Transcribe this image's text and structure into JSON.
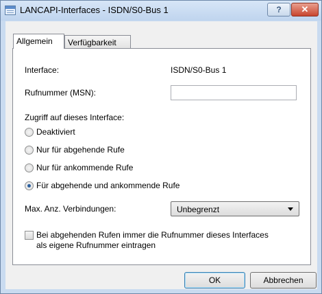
{
  "window": {
    "title": "LANCAPI-Interfaces - ISDN/S0-Bus 1",
    "help_glyph": "?",
    "close_glyph": "✕"
  },
  "tabs": [
    {
      "label": "Allgemein",
      "selected": true
    },
    {
      "label": "Verfügbarkeit",
      "selected": false
    }
  ],
  "form": {
    "interface_label": "Interface:",
    "interface_value": "ISDN/S0-Bus 1",
    "msn_label": "Rufnummer (MSN):",
    "msn_value": "",
    "access_label": "Zugriff auf dieses Interface:",
    "access_options": [
      {
        "label": "Deaktiviert",
        "checked": false
      },
      {
        "label": "Nur für abgehende Rufe",
        "checked": false
      },
      {
        "label": "Nur für ankommende Rufe",
        "checked": false
      },
      {
        "label": "Für abgehende und ankommende Rufe",
        "checked": true
      }
    ],
    "max_conn_label": "Max. Anz. Verbindungen:",
    "max_conn_value": "Unbegrenzt",
    "own_number_line1": "Bei abgehenden Rufen immer die Rufnummer dieses Interfaces",
    "own_number_line2": "als eigene Rufnummer eintragen",
    "own_number_checked": false
  },
  "buttons": {
    "ok": "OK",
    "cancel": "Abbrechen"
  },
  "colors": {
    "frame": "#c9dbf0",
    "radio_dot": "#2b5f9e",
    "close_button": "#c8452f"
  }
}
